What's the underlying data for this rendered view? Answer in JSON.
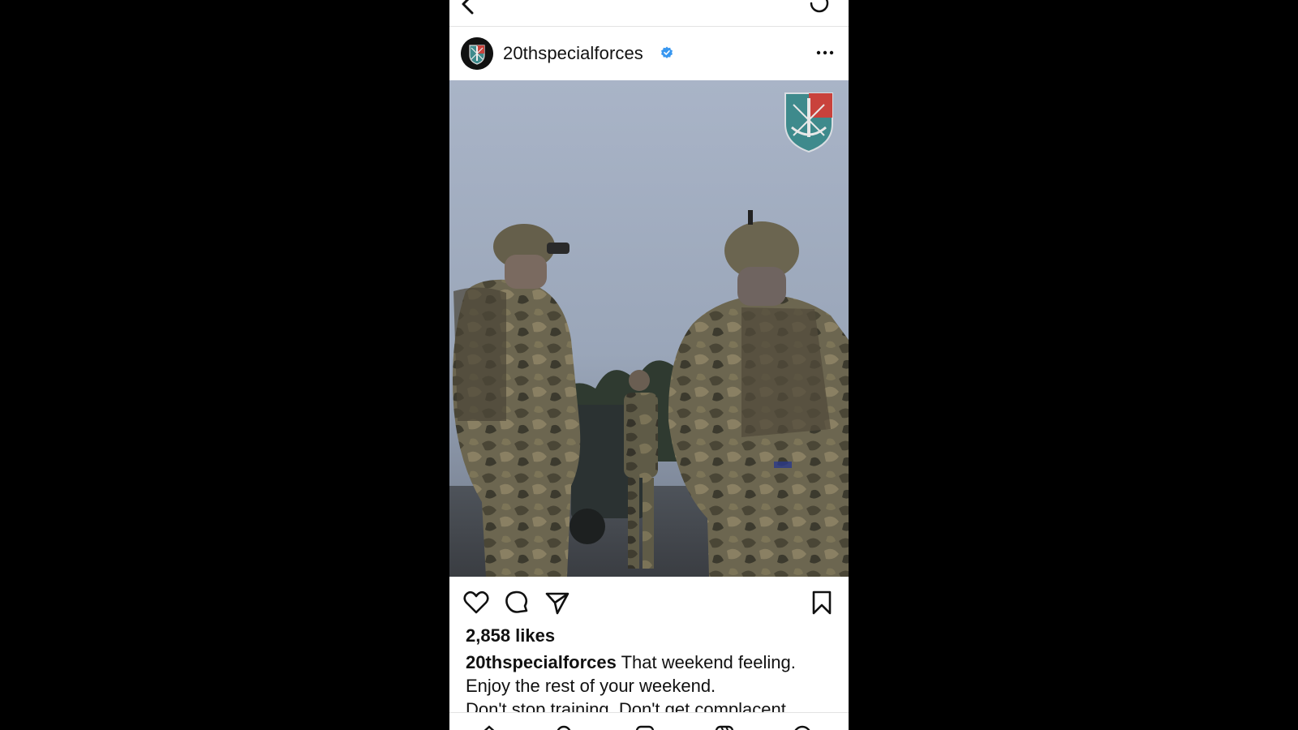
{
  "post": {
    "username": "20thspecialforces",
    "verified": true,
    "likes": "2,858 likes",
    "caption_user": "20thspecialforces",
    "caption_line1": "That weekend feeling.",
    "caption_line2": "Enjoy the rest of your weekend.",
    "caption_line3": "Don't stop training. Don't get complacent."
  },
  "icons": {
    "back": "back-arrow-icon",
    "loading": "loading-spinner-icon",
    "more": "more-options-icon",
    "like": "heart-icon",
    "comment": "comment-icon",
    "share": "share-icon",
    "save": "bookmark-icon"
  },
  "colors": {
    "verified": "#3897f0",
    "background": "#000000",
    "text": "#111111"
  }
}
